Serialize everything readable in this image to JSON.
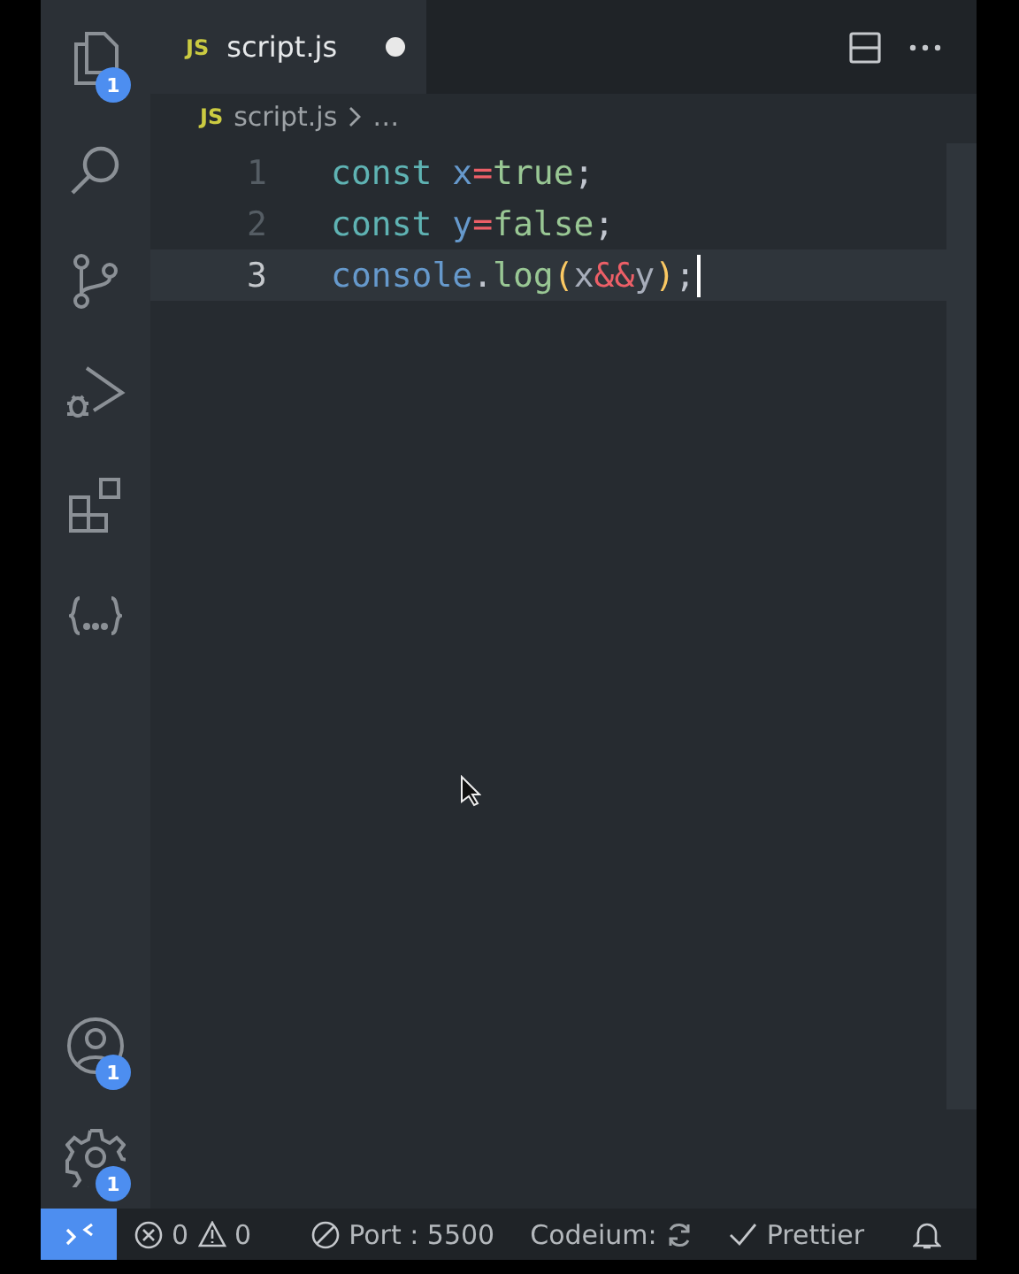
{
  "activity_bar": {
    "items": [
      {
        "kind": "files",
        "badge": "1"
      },
      {
        "kind": "search"
      },
      {
        "kind": "source-control"
      },
      {
        "kind": "run-debug"
      },
      {
        "kind": "extensions"
      },
      {
        "kind": "braces"
      }
    ],
    "bottom_items": [
      {
        "kind": "account",
        "badge": "1"
      },
      {
        "kind": "settings",
        "badge": "1"
      }
    ]
  },
  "tabs": [
    {
      "icon": "JS",
      "label": "script.js",
      "selected": true,
      "modified": true
    }
  ],
  "breadcrumb": {
    "icon": "JS",
    "file": "script.js",
    "rest": "…"
  },
  "editor": {
    "lines": [
      {
        "number": "1",
        "current": false,
        "tokens": [
          {
            "text": "const",
            "kind": "keyword"
          },
          {
            "text": " x",
            "kind": "variable"
          },
          {
            "text": "=",
            "kind": "operator"
          },
          {
            "text": "true",
            "kind": "value"
          },
          {
            "text": ";",
            "kind": "punct"
          }
        ]
      },
      {
        "number": "2",
        "current": false,
        "tokens": [
          {
            "text": "const",
            "kind": "keyword"
          },
          {
            "text": " y",
            "kind": "variable"
          },
          {
            "text": "=",
            "kind": "operator"
          },
          {
            "text": "false",
            "kind": "value"
          },
          {
            "text": ";",
            "kind": "punct"
          }
        ]
      },
      {
        "number": "3",
        "current": true,
        "tokens": [
          {
            "text": "console",
            "kind": "variable"
          },
          {
            "text": ".",
            "kind": "punct"
          },
          {
            "text": "log",
            "kind": "value"
          },
          {
            "text": "(",
            "kind": "bracket"
          },
          {
            "text": "x",
            "kind": "plain"
          },
          {
            "text": "&&",
            "kind": "operator"
          },
          {
            "text": "y",
            "kind": "plain"
          },
          {
            "text": ")",
            "kind": "bracket"
          },
          {
            "text": ";",
            "kind": "punct"
          }
        ]
      }
    ]
  },
  "status_bar": {
    "errors": "0",
    "warnings": "0",
    "port": "Port : 5500",
    "codeium": "Codeium:",
    "prettier": "Prettier"
  }
}
